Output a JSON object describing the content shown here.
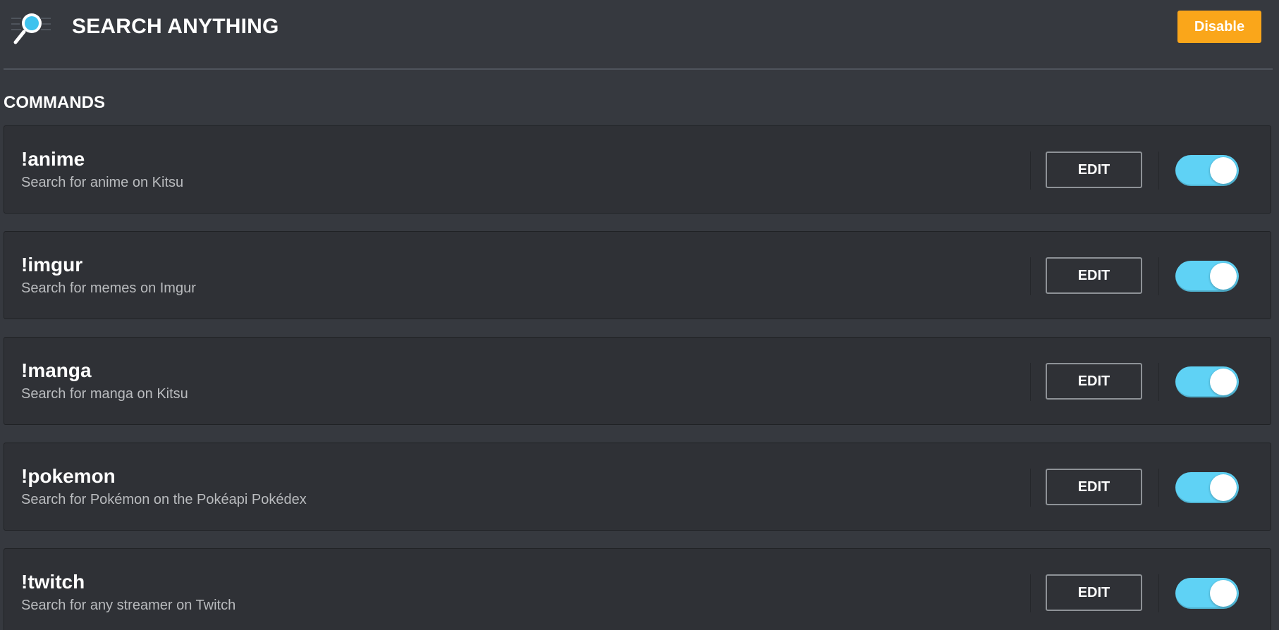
{
  "header": {
    "title": "SEARCH ANYTHING",
    "logo_icon": "magnifier-icon",
    "disable_label": "Disable",
    "accent_color": "#faa61a"
  },
  "section": {
    "title": "COMMANDS"
  },
  "commands": [
    {
      "name": "!anime",
      "description": "Search for anime on Kitsu",
      "edit_label": "EDIT",
      "enabled": true
    },
    {
      "name": "!imgur",
      "description": "Search for memes on Imgur",
      "edit_label": "EDIT",
      "enabled": true
    },
    {
      "name": "!manga",
      "description": "Search for manga on Kitsu",
      "edit_label": "EDIT",
      "enabled": true
    },
    {
      "name": "!pokemon",
      "description": "Search for Pokémon on the Pokéapi Pokédex",
      "edit_label": "EDIT",
      "enabled": true
    },
    {
      "name": "!twitch",
      "description": "Search for any streamer on Twitch",
      "edit_label": "EDIT",
      "enabled": true
    }
  ],
  "colors": {
    "background": "#36393f",
    "card": "#2f3136",
    "toggle_on": "#5fd2f5"
  }
}
